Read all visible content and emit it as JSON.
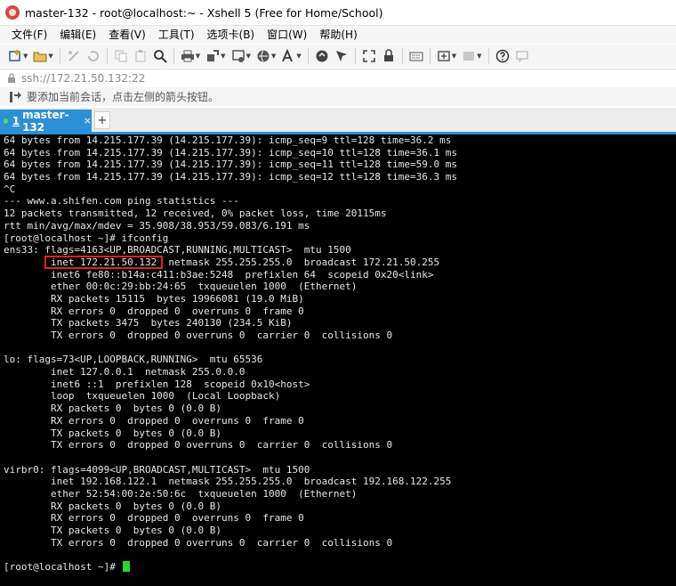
{
  "window": {
    "title": "master-132 - root@localhost:~ - Xshell 5 (Free for Home/School)"
  },
  "menubar": {
    "items": [
      "文件(F)",
      "编辑(E)",
      "查看(V)",
      "工具(T)",
      "选项卡(B)",
      "窗口(W)",
      "帮助(H)"
    ]
  },
  "address": {
    "text": "ssh://172.21.50.132:22"
  },
  "hint": {
    "text": "要添加当前会话，点击左侧的箭头按钮。"
  },
  "tabs": {
    "active": {
      "number": "1",
      "label": "master-132",
      "close": "×"
    },
    "add": "+"
  },
  "terminal": {
    "lines": [
      "64 bytes from 14.215.177.39 (14.215.177.39): icmp_seq=9 ttl=128 time=36.2 ms",
      "64 bytes from 14.215.177.39 (14.215.177.39): icmp_seq=10 ttl=128 time=36.1 ms",
      "64 bytes from 14.215.177.39 (14.215.177.39): icmp_seq=11 ttl=128 time=59.0 ms",
      "64 bytes from 14.215.177.39 (14.215.177.39): icmp_seq=12 ttl=128 time=36.3 ms",
      "^C",
      "--- www.a.shifen.com ping statistics ---",
      "12 packets transmitted, 12 received, 0% packet loss, time 20115ms",
      "rtt min/avg/max/mdev = 35.908/38.953/59.083/6.191 ms",
      "[root@localhost ~]# ifconfig",
      "ens33: flags=4163<UP,BROADCAST,RUNNING,MULTICAST>  mtu 1500",
      "        inet 172.21.50.132  netmask 255.255.255.0  broadcast 172.21.50.255",
      "        inet6 fe80::b14a:c411:b3ae:5248  prefixlen 64  scopeid 0x20<link>",
      "        ether 00:0c:29:bb:24:65  txqueuelen 1000  (Ethernet)",
      "        RX packets 15115  bytes 19966081 (19.0 MiB)",
      "        RX errors 0  dropped 0  overruns 0  frame 0",
      "        TX packets 3475  bytes 240130 (234.5 KiB)",
      "        TX errors 0  dropped 0 overruns 0  carrier 0  collisions 0",
      "",
      "lo: flags=73<UP,LOOPBACK,RUNNING>  mtu 65536",
      "        inet 127.0.0.1  netmask 255.0.0.0",
      "        inet6 ::1  prefixlen 128  scopeid 0x10<host>",
      "        loop  txqueuelen 1000  (Local Loopback)",
      "        RX packets 0  bytes 0 (0.0 B)",
      "        RX errors 0  dropped 0  overruns 0  frame 0",
      "        TX packets 0  bytes 0 (0.0 B)",
      "        TX errors 0  dropped 0 overruns 0  carrier 0  collisions 0",
      "",
      "virbr0: flags=4099<UP,BROADCAST,MULTICAST>  mtu 1500",
      "        inet 192.168.122.1  netmask 255.255.255.0  broadcast 192.168.122.255",
      "        ether 52:54:00:2e:50:6c  txqueuelen 1000  (Ethernet)",
      "        RX packets 0  bytes 0 (0.0 B)",
      "        RX errors 0  dropped 0  overruns 0  frame 0",
      "        TX packets 0  bytes 0 (0.0 B)",
      "        TX errors 0  dropped 0 overruns 0  carrier 0  collisions 0",
      "",
      "[root@localhost ~]# "
    ]
  },
  "colors": {
    "tab_active": "#2d8fd6",
    "terminal_bg": "#000000",
    "terminal_fg": "#e6e6e6",
    "cursor": "#2bd62b",
    "highlight": "#e02020"
  },
  "icons": {
    "toolbar": [
      "new-session-icon",
      "open-folder-icon",
      "disconnect-icon",
      "reconnect-icon",
      "copy-icon",
      "paste-icon",
      "find-icon",
      "print-icon",
      "transfer-icon",
      "properties-icon",
      "globe-icon",
      "font-icon",
      "xftp-icon",
      "xmanager-icon",
      "fullscreen-icon",
      "lock-icon",
      "keyboard-icon",
      "add-tab-icon",
      "layout-icon",
      "help-icon",
      "chat-icon"
    ]
  }
}
